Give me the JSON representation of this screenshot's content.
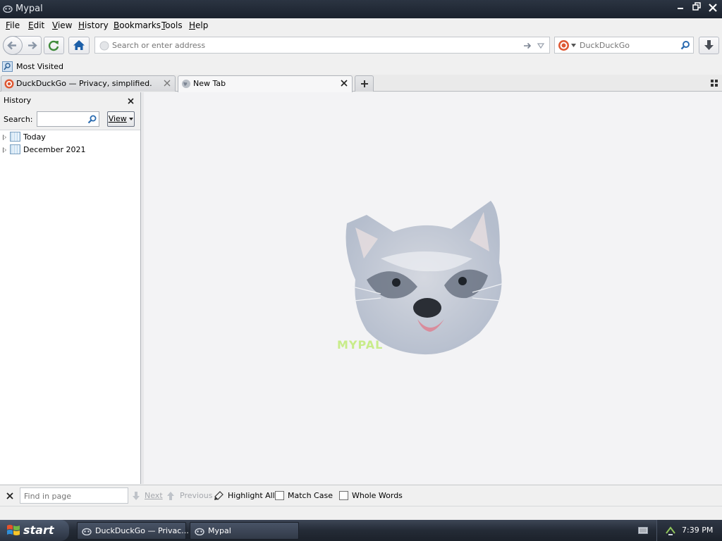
{
  "window": {
    "title": "Mypal",
    "controls": {
      "minimize": "–",
      "restore": "⧉",
      "close": "✕"
    }
  },
  "menu": {
    "items": [
      "File",
      "Edit",
      "View",
      "History",
      "Bookmarks",
      "Tools",
      "Help"
    ]
  },
  "nav": {
    "address_placeholder": "Search or enter address",
    "address_value": "",
    "search_engine": "DuckDuckGo",
    "search_placeholder": "DuckDuckGo"
  },
  "bookmarks_bar": {
    "items": [
      {
        "label": "Most Visited"
      }
    ]
  },
  "tabs": [
    {
      "label": "DuckDuckGo — Privacy, simplified.",
      "active": false
    },
    {
      "label": "New Tab",
      "active": true
    }
  ],
  "sidebar": {
    "title": "History",
    "search_label": "Search:",
    "search_value": "",
    "view_button": "View",
    "tree": [
      {
        "label": "Today"
      },
      {
        "label": "December 2021"
      }
    ]
  },
  "content": {
    "logo_text": "MYPAL"
  },
  "findbar": {
    "placeholder": "Find in page",
    "next_label": "Next",
    "previous_label": "Previous",
    "highlight_label": "Highlight All",
    "match_case_label": "Match Case",
    "whole_words_label": "Whole Words",
    "match_case_checked": false,
    "whole_words_checked": false
  },
  "taskbar": {
    "start_label": "start",
    "items": [
      {
        "label": "DuckDuckGo — Privac..."
      },
      {
        "label": "Mypal"
      }
    ],
    "clock": "7:39 PM"
  },
  "colors": {
    "titlebar": "#1f2631",
    "content_bg": "#f3f3f5",
    "accent_blue": "#2a6bb0",
    "ddg_orange": "#de5833",
    "logo_green": "#c8ec8a"
  }
}
